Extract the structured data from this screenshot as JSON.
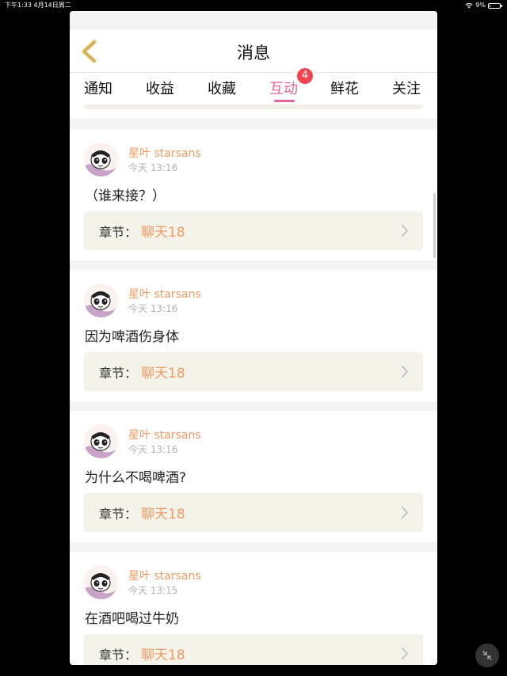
{
  "status_bar": {
    "time_date": "下午1:33   4月14日周二",
    "battery": "9%",
    "battery_level": 0.09
  },
  "nav": {
    "title": "消息",
    "back_icon": "chevron-left-icon"
  },
  "tabs": [
    {
      "label": "通知"
    },
    {
      "label": "收益"
    },
    {
      "label": "收藏"
    },
    {
      "label": "互动",
      "active": true,
      "badge": "4"
    },
    {
      "label": "鲜花"
    },
    {
      "label": "关注"
    }
  ],
  "messages": [
    {
      "user": "星叶 starsans",
      "time": "今天 13:16",
      "content": "（谁来接？）",
      "chapter_label": "章节：",
      "chapter": "聊天18"
    },
    {
      "user": "星叶 starsans",
      "time": "今天 13:16",
      "content": "因为啤酒伤身体",
      "chapter_label": "章节：",
      "chapter": "聊天18"
    },
    {
      "user": "星叶 starsans",
      "time": "今天 13:16",
      "content": "为什么不喝啤酒?",
      "chapter_label": "章节：",
      "chapter": "聊天18"
    },
    {
      "user": "星叶 starsans",
      "time": "今天 13:15",
      "content": "在酒吧喝过牛奶",
      "chapter_label": "章节：",
      "chapter": "聊天18"
    }
  ],
  "colors": {
    "accent": "#e5659d",
    "username": "#f09a63",
    "badge": "#f2434f",
    "chapter_bg": "#f3f3ea",
    "back_icon": "#e6c36a"
  }
}
